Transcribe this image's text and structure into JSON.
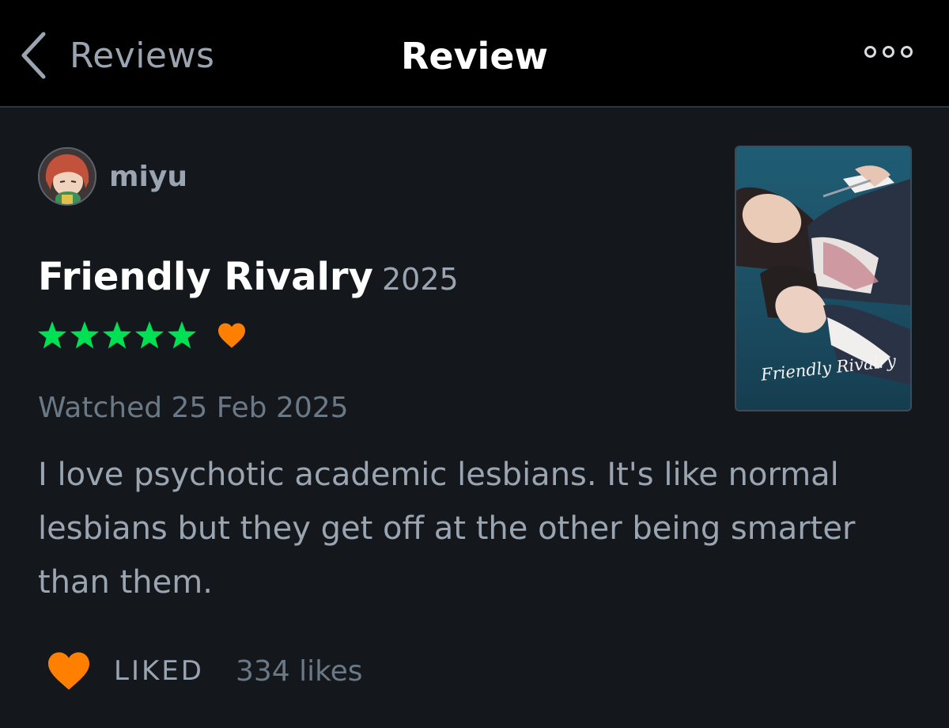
{
  "navbar": {
    "back_label": "Reviews",
    "title": "Review"
  },
  "review": {
    "username": "miyu",
    "film_title": "Friendly Rivalry",
    "film_year": "2025",
    "rating_stars": 5,
    "liked_film": true,
    "watched_date": "Watched 25 Feb 2025",
    "text": "I love psychotic academic lesbians. It's like normal lesbians but they get off at the other being smarter than them.",
    "poster_title": "Friendly Rivalry"
  },
  "likes": {
    "liked_label": "LIKED",
    "count_text": "334 likes"
  },
  "icons": {
    "back": "chevron-left-icon",
    "more": "more-dots-icon",
    "star": "star-icon",
    "heart": "heart-icon"
  },
  "colors": {
    "background": "#14181c",
    "navbar": "#000000",
    "star_green": "#00e054",
    "heart_orange": "#ff8000",
    "muted_text": "#9aa5b1",
    "dim_text": "#6b7886"
  }
}
